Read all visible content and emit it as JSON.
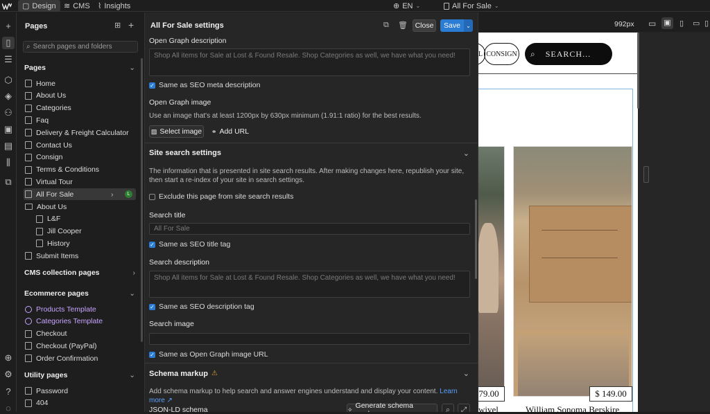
{
  "topbar": {
    "design": "Design",
    "cms": "CMS",
    "insights": "Insights",
    "lang": "EN",
    "page": "All For Sale"
  },
  "pages_panel": {
    "title": "Pages",
    "search_placeholder": "Search pages and folders",
    "sections": {
      "pages": "Pages",
      "cms": "CMS collection pages",
      "ecommerce": "Ecommerce pages",
      "utility": "Utility pages"
    },
    "pages": [
      "Home",
      "About Us",
      "Categories",
      "Faq",
      "Delivery & Freight Calculator",
      "Contact Us",
      "Consign",
      "Terms & Conditions",
      "Virtual Tour",
      "All For Sale"
    ],
    "folder": "About Us",
    "folder_children": [
      "L&F",
      "Jill Cooper",
      "History"
    ],
    "after_folder": [
      "Submit Items"
    ],
    "ecommerce_pages": [
      "Products Template",
      "Categories Template",
      "Checkout",
      "Checkout (PayPal)",
      "Order Confirmation"
    ],
    "utility_pages": [
      "Password",
      "404"
    ],
    "badge": "L"
  },
  "settings": {
    "title": "All For Sale settings",
    "close": "Close",
    "save": "Save",
    "og_desc_label": "Open Graph description",
    "og_desc_value": "Shop All items for Sale at Lost & Found Resale.  Shop Categories as well, we have what you need!",
    "same_seo_meta": "Same as SEO meta description",
    "og_image_label": "Open Graph image",
    "og_image_hint": "Use an image that's at least 1200px by 630px minimum (1.91:1 ratio) for the best results.",
    "select_image": "Select image",
    "add_url": "Add URL",
    "site_search_head": "Site search settings",
    "site_search_hint": "The information that is presented in site search results. After making changes here, republish your site, then start a re-index of your site in search settings.",
    "exclude": "Exclude this page from site search results",
    "search_title_label": "Search title",
    "search_title_value": "All For Sale",
    "same_seo_title": "Same as SEO title tag",
    "search_desc_label": "Search description",
    "search_desc_value": "Shop All items for Sale at Lost & Found Resale.  Shop Categories as well, we have what you need!",
    "same_seo_desc": "Same as SEO description tag",
    "search_image_label": "Search image",
    "same_og_url": "Same as Open Graph image URL",
    "schema_head": "Schema markup",
    "schema_hint": "Add schema markup to help search and answer engines understand and display your content.",
    "learn_more": "Learn more ↗",
    "jsonld": "JSON-LD schema",
    "generate": "Generate schema markup"
  },
  "canvas": {
    "width_label": "992px",
    "consign": "CONSIGN",
    "nav_left": "L",
    "search": "SEARCH...",
    "price1": "79.00",
    "price2": "$ 149.00",
    "name1": "wivel",
    "name2": "William Sonoma Berskire"
  },
  "colors": {
    "accent": "#2b7cd3",
    "purple": "#c7a4ff"
  }
}
